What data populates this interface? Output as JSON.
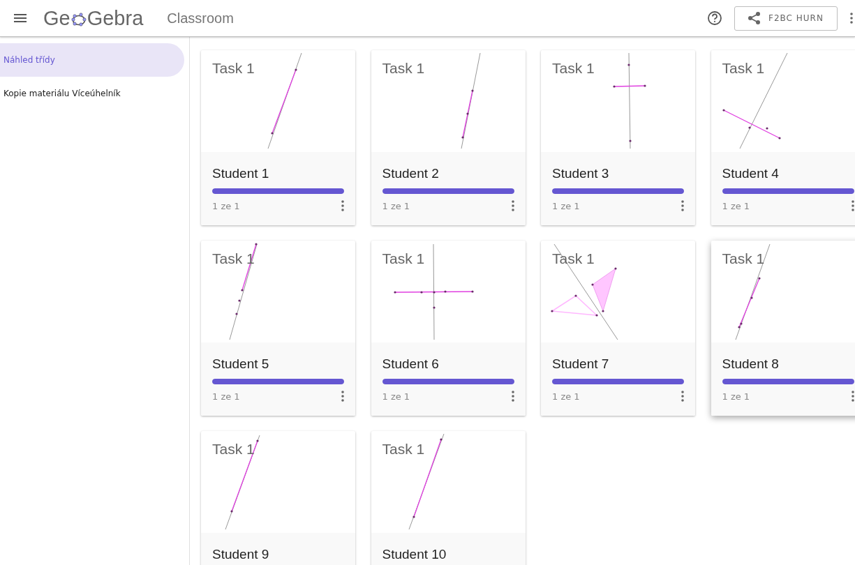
{
  "header": {
    "logo_parts": [
      "Ge",
      "Gebra"
    ],
    "app_name": "Classroom",
    "share_button": "F2BC HURN"
  },
  "sidebar": {
    "items": [
      {
        "label": "Náhled třídy",
        "selected": true
      },
      {
        "label": "Kopie materiálu Víceúhelník",
        "selected": false
      }
    ]
  },
  "cards": [
    {
      "task": "Task 1",
      "student": "Student 1",
      "level": 1,
      "progress_text": "1 ze 1",
      "hovered": false,
      "thumbnail": {
        "kind": "segment"
      }
    },
    {
      "task": "Task 1",
      "student": "Student 2",
      "level": 1,
      "progress_text": "1 ze 1",
      "hovered": false,
      "thumbnail": {
        "kind": "segment"
      }
    },
    {
      "task": "Task 1",
      "student": "Student 3",
      "level": 1,
      "progress_text": "1 ze 1",
      "hovered": false,
      "thumbnail": {
        "kind": "cross"
      }
    },
    {
      "task": "Task 1",
      "student": "Student 4",
      "level": 1,
      "progress_text": "1 ze 1",
      "hovered": false,
      "thumbnail": {
        "kind": "cross"
      }
    },
    {
      "task": "Task 1",
      "student": "Student 5",
      "level": 1,
      "progress_text": "1 ze 1",
      "hovered": false,
      "thumbnail": {
        "kind": "segment"
      }
    },
    {
      "task": "Task 1",
      "student": "Student 6",
      "level": 1,
      "progress_text": "1 ze 1",
      "hovered": false,
      "thumbnail": {
        "kind": "cross"
      }
    },
    {
      "task": "Task 1",
      "student": "Student 7",
      "level": 1,
      "progress_text": "1 ze 1",
      "hovered": false,
      "thumbnail": {
        "kind": "triangles"
      }
    },
    {
      "task": "Task 1",
      "student": "Student 8",
      "level": 1,
      "progress_text": "1 ze 1",
      "hovered": true,
      "thumbnail": {
        "kind": "segment"
      }
    },
    {
      "task": "Task 1",
      "student": "Student 9",
      "thumbnail": {
        "kind": "segment"
      }
    },
    {
      "task": "Task 1",
      "student": "Student 10",
      "thumbnail": {
        "kind": "segment"
      }
    }
  ]
}
